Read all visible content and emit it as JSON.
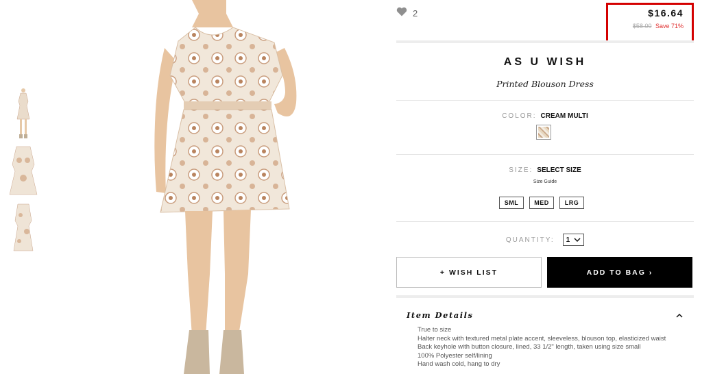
{
  "favorites": {
    "count": "2"
  },
  "pricing": {
    "price": "$16.64",
    "original": "$58.00",
    "save": "Save 71%"
  },
  "product": {
    "brand": "AS U WISH",
    "name": "Printed Blouson Dress"
  },
  "color": {
    "label": "COLOR:",
    "value": "CREAM MULTI"
  },
  "size": {
    "label": "SIZE:",
    "value": "SELECT SIZE",
    "guide": "Size Guide",
    "options": [
      "SML",
      "MED",
      "LRG"
    ]
  },
  "quantity": {
    "label": "QUANTITY:",
    "value": "1"
  },
  "actions": {
    "wish_list": "+ WISH LIST",
    "add_to_bag": "ADD TO BAG ›"
  },
  "details": {
    "title": "Item Details",
    "lines": [
      "True to size",
      "Halter neck with textured metal plate accent, sleeveless, blouson top, elasticized waist",
      "Back keyhole with button closure, lined, 33 1/2\" length, taken using size small",
      "100% Polyester self/lining",
      "Hand wash cold, hang to dry"
    ]
  },
  "colors": {
    "accent_red": "#d40000",
    "save_red": "#e03030",
    "button_black": "#000000"
  },
  "icons": {
    "favorite": "heart-icon",
    "select_arrow": "chevron-down-icon",
    "collapse": "chevron-up-icon"
  }
}
